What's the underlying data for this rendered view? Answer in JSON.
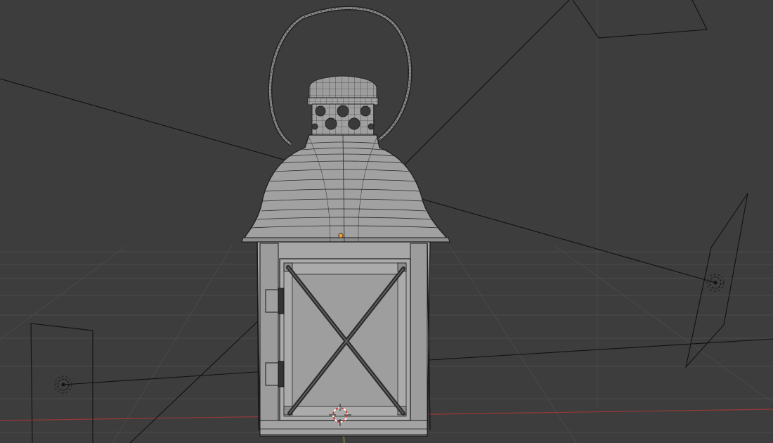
{
  "viewport": {
    "view": "3d-viewport",
    "shading": "solid-wireframe-overlay",
    "background_color": "#3d3d3d",
    "grid_color": "#4a4a4a",
    "x_axis_color": "#9a3838",
    "y_axis_color": "#7fa63a",
    "wire_color": "#111111",
    "selected_origin_color": "#f0a030",
    "cursor_color": "#c0392b"
  },
  "scene_objects": [
    {
      "name": "lantern",
      "kind": "mesh"
    },
    {
      "name": "area-light-left",
      "kind": "light"
    },
    {
      "name": "area-light-right",
      "kind": "light"
    },
    {
      "name": "area-light-top",
      "kind": "light"
    },
    {
      "name": "3d-cursor",
      "kind": "cursor"
    }
  ],
  "icons": [
    "light-gizmo-icon",
    "3d-cursor-icon",
    "origin-dot-icon"
  ]
}
